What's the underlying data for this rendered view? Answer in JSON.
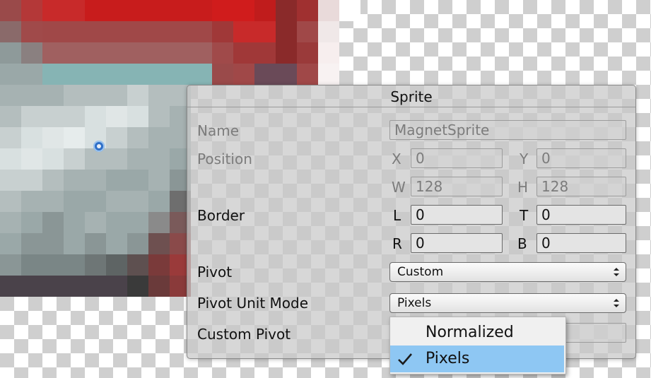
{
  "panel": {
    "title": "Sprite",
    "name": {
      "label": "Name",
      "value": "MagnetSprite"
    },
    "position": {
      "label": "Position",
      "x_label": "X",
      "x_value": "0",
      "y_label": "Y",
      "y_value": "0",
      "w_label": "W",
      "w_value": "128",
      "h_label": "H",
      "h_value": "128"
    },
    "border": {
      "label": "Border",
      "l_label": "L",
      "l_value": "0",
      "t_label": "T",
      "t_value": "0",
      "r_label": "R",
      "r_value": "0",
      "b_label": "B",
      "b_value": "0"
    },
    "pivot": {
      "label": "Pivot",
      "value": "Custom"
    },
    "pivot_unit_mode": {
      "label": "Pivot Unit Mode",
      "value": "Pixels"
    },
    "custom_pivot": {
      "label": "Custom Pivot"
    }
  },
  "popup": {
    "options": [
      {
        "label": "Normalized",
        "selected": false
      },
      {
        "label": "Pixels",
        "selected": true
      }
    ]
  },
  "colors": {
    "selection": "#8ec7f3",
    "pivot_handle": "#2f6fc7"
  }
}
